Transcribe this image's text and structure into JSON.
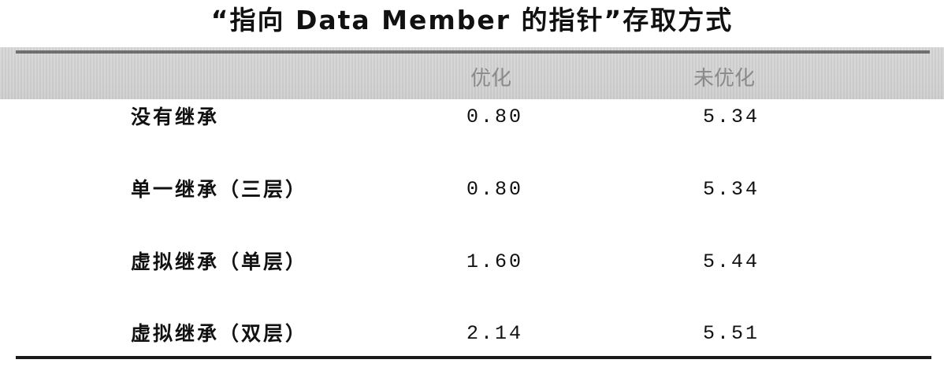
{
  "title": "“指向 Data Member 的指针”存取方式",
  "table": {
    "columns": [
      "优化",
      "未优化"
    ],
    "rows": [
      {
        "label": "没有继承",
        "optimized": "0.80",
        "unoptimized": "5.34"
      },
      {
        "label": "单一继承（三层）",
        "optimized": "0.80",
        "unoptimized": "5.34"
      },
      {
        "label": "虚拟继承（单层）",
        "optimized": "1.60",
        "unoptimized": "5.44"
      },
      {
        "label": "虚拟继承（双层）",
        "optimized": "2.14",
        "unoptimized": "5.51"
      }
    ]
  },
  "colors": {
    "header_band": "#d2d2d2",
    "header_text": "#8a8a8a",
    "rule": "#1a1a1a",
    "text": "#111111"
  }
}
